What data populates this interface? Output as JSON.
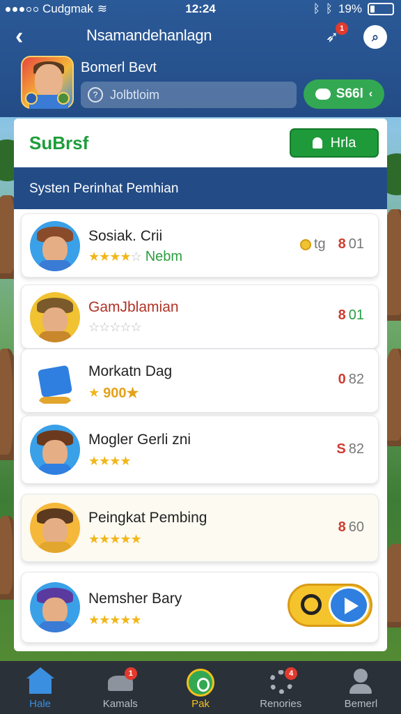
{
  "status_bar": {
    "carrier": "Cudgmak",
    "time": "12:24",
    "battery": "19%"
  },
  "header": {
    "title": "Nsamandehanlagn",
    "share_badge": "1",
    "username": "Bomerl Bevt",
    "search_placeholder": "Jolbtloim",
    "coin_button": "S66l"
  },
  "panel": {
    "title": "SuBrsf",
    "top_button": "Hrla",
    "section_title": "Systen Perinhat Pemhian"
  },
  "list": [
    {
      "name": "Sosiak. Crii",
      "stars": "★★★★",
      "empty_stars": "☆",
      "tag": "Nebm",
      "coin_label": "tg",
      "value_a": "8",
      "value_b": "01",
      "hat": "#8a4b2a",
      "body": "#3a7bd5",
      "ring": "#3aa0e8"
    },
    {
      "name": "GamJblamian",
      "stars": "",
      "empty_stars": "☆☆☆☆☆",
      "tag": "",
      "coin_label": "",
      "value_a": "8",
      "value_b": "01",
      "hat": "#7a5a2a",
      "body": "#c9872c",
      "ring": "#f1c232"
    },
    {
      "name": "Morkatn Dag",
      "stars": "★",
      "empty_stars": "",
      "tag": "900★",
      "coin_label": "",
      "value_a": "0",
      "value_b": "82",
      "hat": "#2f7fe0",
      "body": "#e3a62c",
      "ring": "#ffffff"
    },
    {
      "name": "Mogler Gerli      zni",
      "stars": "★★★★",
      "empty_stars": "",
      "tag": "",
      "coin_label": "",
      "value_a": "S",
      "value_b": "82",
      "hat": "#6b3a1e",
      "body": "#2f7fe0",
      "ring": "#3aa0e8"
    },
    {
      "name": "Peingkat Pembing",
      "stars": "★★★★★",
      "empty_stars": "",
      "tag": "",
      "coin_label": "",
      "value_a": "8",
      "value_b": "60",
      "hat": "#5b3a1f",
      "body": "#e3a62c",
      "ring": "#f5b83a"
    },
    {
      "name": "Nemsher Bary",
      "stars": "★★★★★",
      "empty_stars": "",
      "tag": "",
      "coin_label": "",
      "value_a": "",
      "value_b": "",
      "hat": "#5b3aa0",
      "body": "#3a7bd5",
      "ring": "#3aa0e8"
    }
  ],
  "tabs": [
    {
      "label": "Hale",
      "badge": ""
    },
    {
      "label": "Kamals",
      "badge": "1"
    },
    {
      "label": "Pak",
      "badge": ""
    },
    {
      "label": "Renories",
      "badge": "4"
    },
    {
      "label": "Bemerl",
      "badge": ""
    }
  ]
}
